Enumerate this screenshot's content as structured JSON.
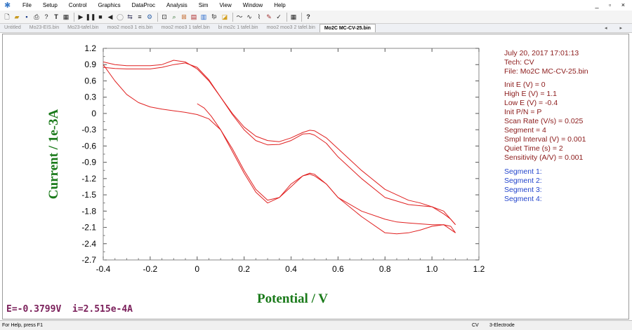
{
  "menubar": {
    "items": [
      "File",
      "Setup",
      "Control",
      "Graphics",
      "DataProc",
      "Analysis",
      "Sim",
      "View",
      "Window",
      "Help"
    ],
    "window_controls": "_ ▫ ×"
  },
  "toolbar": {
    "icons": [
      "new-file-icon",
      "open-file-icon",
      "save-icon",
      "print-icon",
      "help-pointer-icon",
      "text-icon",
      "select-tool-icon",
      "run-icon",
      "pause-icon",
      "stop-icon",
      "reverse-icon",
      "cell-icon",
      "parameters-icon",
      "technique-icon",
      "settings-icon",
      "zoom-icon",
      "magnifier-icon",
      "overlay-icon",
      "stats-icon",
      "bar-chart-icon",
      "fp-icon",
      "palette-icon",
      "wave-icon",
      "waveform-icon",
      "spline-icon",
      "edit-icon",
      "check-icon",
      "grid-icon",
      "context-help-icon"
    ],
    "fp_label": "fp"
  },
  "tabs": [
    {
      "label": "Untitled",
      "active": false
    },
    {
      "label": "Mo23-EIS.bin",
      "active": false
    },
    {
      "label": "Mo23-tafel.bin",
      "active": false
    },
    {
      "label": "moo2 moo3 1 eis.bin",
      "active": false
    },
    {
      "label": "moo2 moo3 1 tafel.bin",
      "active": false
    },
    {
      "label": "bi mo2c 1 tafel.bin",
      "active": false
    },
    {
      "label": "moo2 moo3 2 tafel.bin",
      "active": false
    },
    {
      "label": "Mo2C MC-CV-25.bin",
      "active": true
    }
  ],
  "tab_arrows": "◂ ▸",
  "info": {
    "datetime": "July 20, 2017    17:01:13",
    "tech": "Tech: CV",
    "file": "File: Mo2C MC-CV-25.bin",
    "params": [
      "Init E (V) = 0",
      "High E (V) = 1.1",
      "Low E (V) = -0.4",
      "Init P/N = P",
      "Scan Rate (V/s) = 0.025",
      "Segment = 4",
      "Smpl Interval (V) = 0.001",
      "Quiet Time (s) = 2",
      "Sensitivity (A/V) = 0.001"
    ],
    "segments": [
      "Segment 1:",
      "Segment 2:",
      "Segment 3:",
      "Segment 4:"
    ]
  },
  "readout": "E=-0.3799V  i=2.515e-4A",
  "status": {
    "help": "For Help, press F1",
    "mode": "CV",
    "electrode": "3-Electrode"
  },
  "colors": {
    "curve": "#e02020",
    "axis_label": "#1a7a1a",
    "info_text": "#8b1a1a",
    "segment_text": "#2244cc",
    "readout": "#7a1f5a"
  },
  "chart_data": {
    "type": "line",
    "title": "",
    "xlabel": "Potential / V",
    "ylabel": "Current / 1e-3A",
    "xlim": [
      -0.4,
      1.2
    ],
    "ylim": [
      -2.7,
      1.2
    ],
    "xticks": [
      -0.4,
      -0.2,
      0,
      0.2,
      0.4,
      0.6,
      0.8,
      1.0,
      1.2
    ],
    "yticks": [
      1.2,
      0.9,
      0.6,
      0.3,
      0,
      -0.3,
      -0.6,
      -0.9,
      -1.2,
      -1.5,
      -1.8,
      -2.1,
      -2.4,
      -2.7
    ],
    "xtick_labels": [
      "-0.4",
      "-0.2",
      "0",
      "0.2",
      "0.4",
      "0.6",
      "0.8",
      "1.0",
      "1.2"
    ],
    "ytick_labels": [
      "1.2",
      "0.9",
      "0.6",
      "0.3",
      "0",
      "-0.3",
      "-0.6",
      "-0.9",
      "-1.2",
      "-1.5",
      "-1.8",
      "-2.1",
      "-2.4",
      "-2.7"
    ],
    "grid": false,
    "series": [
      {
        "x": [
          0,
          0.03,
          0.06,
          0.1,
          0.15,
          0.2,
          0.25,
          0.3,
          0.35,
          0.4,
          0.45,
          0.48,
          0.5,
          0.55,
          0.6,
          0.7,
          0.8,
          0.85,
          0.9,
          1.0,
          1.05,
          1.08,
          1.1
        ],
        "y": [
          0.18,
          0.1,
          -0.05,
          -0.3,
          -0.7,
          -1.1,
          -1.45,
          -1.65,
          -1.55,
          -1.3,
          -1.15,
          -1.1,
          -1.12,
          -1.3,
          -1.55,
          -1.8,
          -1.95,
          -2.0,
          -2.02,
          -2.05,
          -2.05,
          -2.08,
          -2.2
        ]
      },
      {
        "x": [
          1.1,
          1.05,
          1.0,
          0.95,
          0.9,
          0.85,
          0.8,
          0.7,
          0.6,
          0.55,
          0.5,
          0.48,
          0.45,
          0.4,
          0.35,
          0.3,
          0.25,
          0.2,
          0.15,
          0.1,
          0.05,
          0.0,
          -0.05,
          -0.1,
          -0.15,
          -0.2,
          -0.25,
          -0.3,
          -0.35,
          -0.4
        ],
        "y": [
          -2.2,
          -2.05,
          -2.08,
          -2.15,
          -2.2,
          -2.22,
          -2.2,
          -1.9,
          -1.55,
          -1.3,
          -1.15,
          -1.12,
          -1.15,
          -1.35,
          -1.55,
          -1.6,
          -1.4,
          -1.05,
          -0.65,
          -0.3,
          -0.1,
          -0.02,
          0.02,
          0.05,
          0.08,
          0.12,
          0.2,
          0.35,
          0.6,
          0.9
        ]
      },
      {
        "x": [
          -0.4,
          -0.35,
          -0.3,
          -0.25,
          -0.2,
          -0.15,
          -0.1,
          -0.05,
          0.0,
          0.05,
          0.1,
          0.15,
          0.2,
          0.25,
          0.3,
          0.35,
          0.4,
          0.45,
          0.48,
          0.5,
          0.55,
          0.6,
          0.7,
          0.8,
          0.9,
          0.95,
          1.0,
          1.05,
          1.08,
          1.1
        ],
        "y": [
          0.95,
          0.9,
          0.88,
          0.88,
          0.88,
          0.9,
          0.98,
          0.95,
          0.82,
          0.6,
          0.3,
          0.0,
          -0.25,
          -0.42,
          -0.5,
          -0.52,
          -0.45,
          -0.35,
          -0.31,
          -0.32,
          -0.45,
          -0.65,
          -1.05,
          -1.4,
          -1.6,
          -1.65,
          -1.72,
          -1.85,
          -1.95,
          -2.05
        ]
      },
      {
        "x": [
          1.1,
          1.05,
          1.0,
          0.95,
          0.9,
          0.8,
          0.7,
          0.6,
          0.55,
          0.5,
          0.48,
          0.45,
          0.4,
          0.35,
          0.3,
          0.25,
          0.2,
          0.15,
          0.1,
          0.05,
          0.0,
          -0.05,
          -0.1,
          -0.15,
          -0.2,
          -0.25,
          -0.3,
          -0.35,
          -0.4
        ],
        "y": [
          -2.05,
          -1.8,
          -1.72,
          -1.7,
          -1.68,
          -1.55,
          -1.2,
          -0.8,
          -0.55,
          -0.4,
          -0.37,
          -0.38,
          -0.5,
          -0.57,
          -0.58,
          -0.5,
          -0.3,
          -0.02,
          0.3,
          0.62,
          0.85,
          0.93,
          0.9,
          0.85,
          0.82,
          0.82,
          0.82,
          0.83,
          0.85
        ]
      }
    ]
  }
}
